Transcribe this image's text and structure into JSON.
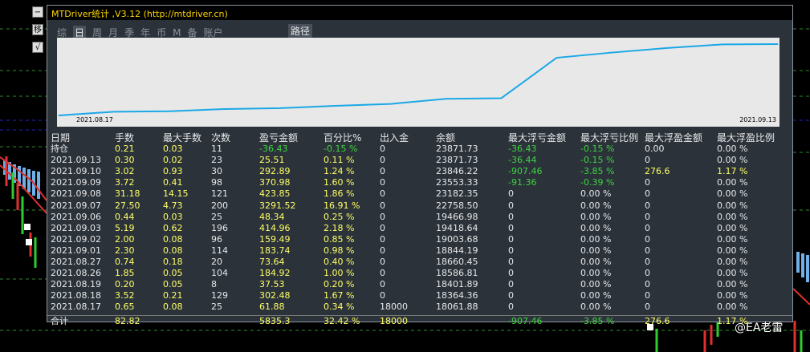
{
  "panel": {
    "title": "MTDriver统计 ,V3.12 (http://mtdriver.cn)",
    "tabs": [
      "综",
      "日",
      "周",
      "月",
      "季",
      "年",
      "币",
      "M",
      "备",
      "账户"
    ],
    "active_tab": "日",
    "path_tab": "路径"
  },
  "toolbar": {
    "minimize": "−",
    "move": "移",
    "check": "√"
  },
  "watermark": "@EA老雷",
  "chart": {
    "start_date": "2021.08.17",
    "end_date": "2021.09.13",
    "line_color": "#1aa8e6",
    "background": "#e8e8e8"
  },
  "chart_data": {
    "type": "line",
    "x": [
      "2021.08.17",
      "2021.08.18",
      "2021.08.19",
      "2021.08.26",
      "2021.08.27",
      "2021.09.01",
      "2021.09.02",
      "2021.09.03",
      "2021.09.06",
      "2021.09.07",
      "2021.09.08",
      "2021.09.09",
      "2021.09.10",
      "2021.09.13"
    ],
    "values": [
      18061.88,
      18364.36,
      18401.89,
      18586.81,
      18660.45,
      18844.19,
      19003.68,
      19418.64,
      19466.98,
      22758.5,
      23182.35,
      23553.33,
      23846.22,
      23871.73
    ],
    "xlabel": "",
    "ylabel": "",
    "grid": false
  },
  "table": {
    "headers": [
      "日期",
      "手数",
      "最大手数",
      "次数",
      "盈亏金额",
      "百分比%",
      "出入金",
      "余额",
      "最大浮亏金额",
      "最大浮亏比例",
      "最大浮盈金额",
      "最大浮盈比例"
    ],
    "rows": [
      [
        "持仓",
        "0.21",
        "0.03",
        "11",
        "-36.43",
        "-0.15 %",
        "0",
        "23871.73",
        "-36.43",
        "-0.15 %",
        "0.00",
        "0.00 %"
      ],
      [
        "2021.09.13",
        "0.30",
        "0.02",
        "23",
        "25.51",
        "0.11 %",
        "0",
        "23871.73",
        "-36.44",
        "-0.15 %",
        "0",
        "0.00 %"
      ],
      [
        "2021.09.10",
        "3.02",
        "0.93",
        "30",
        "292.89",
        "1.24 %",
        "0",
        "23846.22",
        "-907.46",
        "-3.85 %",
        "276.6",
        "1.17 %"
      ],
      [
        "2021.09.09",
        "3.72",
        "0.41",
        "98",
        "370.98",
        "1.60 %",
        "0",
        "23553.33",
        "-91.36",
        "-0.39 %",
        "0",
        "0.00 %"
      ],
      [
        "2021.09.08",
        "31.18",
        "14.15",
        "121",
        "423.85",
        "1.86 %",
        "0",
        "23182.35",
        "0",
        "0.00 %",
        "0",
        "0.00 %"
      ],
      [
        "2021.09.07",
        "27.50",
        "4.73",
        "200",
        "3291.52",
        "16.91 %",
        "0",
        "22758.50",
        "0",
        "0.00 %",
        "0",
        "0.00 %"
      ],
      [
        "2021.09.06",
        "0.44",
        "0.03",
        "25",
        "48.34",
        "0.25 %",
        "0",
        "19466.98",
        "0",
        "0.00 %",
        "0",
        "0.00 %"
      ],
      [
        "2021.09.03",
        "5.19",
        "0.62",
        "196",
        "414.96",
        "2.18 %",
        "0",
        "19418.64",
        "0",
        "0.00 %",
        "0",
        "0.00 %"
      ],
      [
        "2021.09.02",
        "2.00",
        "0.08",
        "96",
        "159.49",
        "0.85 %",
        "0",
        "19003.68",
        "0",
        "0.00 %",
        "0",
        "0.00 %"
      ],
      [
        "2021.09.01",
        "2.30",
        "0.08",
        "114",
        "183.74",
        "0.98 %",
        "0",
        "18844.19",
        "0",
        "0.00 %",
        "0",
        "0.00 %"
      ],
      [
        "2021.08.27",
        "0.74",
        "0.18",
        "20",
        "73.64",
        "0.40 %",
        "0",
        "18660.45",
        "0",
        "0.00 %",
        "0",
        "0.00 %"
      ],
      [
        "2021.08.26",
        "1.85",
        "0.05",
        "104",
        "184.92",
        "1.00 %",
        "0",
        "18586.81",
        "0",
        "0.00 %",
        "0",
        "0.00 %"
      ],
      [
        "2021.08.19",
        "0.20",
        "0.05",
        "8",
        "37.53",
        "0.20 %",
        "0",
        "18401.89",
        "0",
        "0.00 %",
        "0",
        "0.00 %"
      ],
      [
        "2021.08.18",
        "3.52",
        "0.21",
        "129",
        "302.48",
        "1.67 %",
        "0",
        "18364.36",
        "0",
        "0.00 %",
        "0",
        "0.00 %"
      ],
      [
        "2021.08.17",
        "0.65",
        "0.08",
        "25",
        "61.88",
        "0.34 %",
        "18000",
        "18061.88",
        "0",
        "0.00 %",
        "0",
        "0.00 %"
      ]
    ],
    "total": [
      "合计",
      "82.82",
      "",
      "",
      "5835.3",
      "32.42 %",
      "18000",
      "",
      "-907.46",
      "-3.85 %",
      "276.6",
      "1.17 %"
    ]
  },
  "colors": {
    "accent_yellow": "#ffff66",
    "accent_green": "#3fd43f",
    "title_yellow": "#ffd700"
  }
}
